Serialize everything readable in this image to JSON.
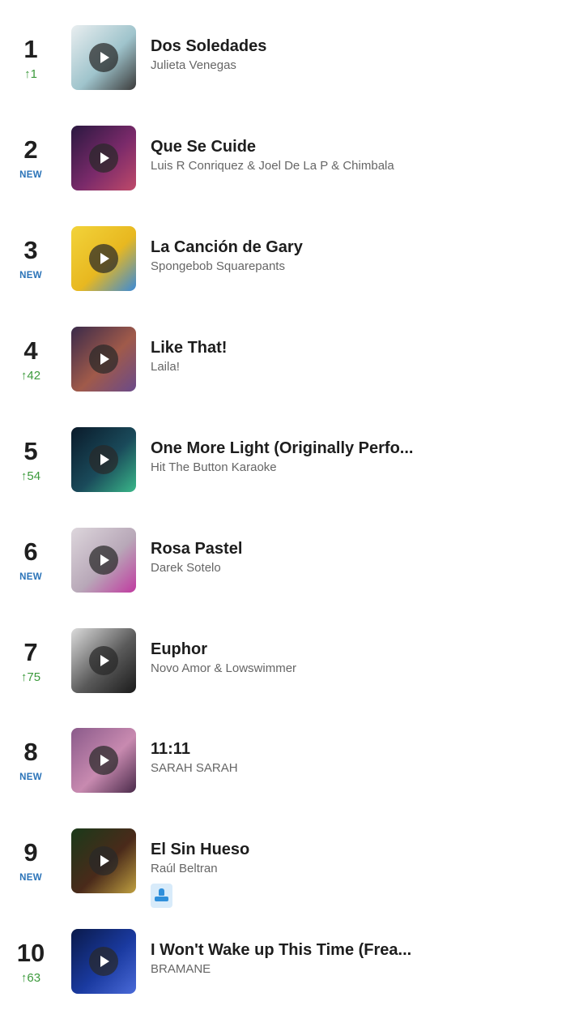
{
  "tracks": [
    {
      "rank": "1",
      "change": "1",
      "change_type": "up",
      "title": "Dos Soledades",
      "artist": "Julieta Venegas",
      "art_colors": [
        "#e9eef0",
        "#9fc4cc",
        "#3a3a3a"
      ]
    },
    {
      "rank": "2",
      "change": "NEW",
      "change_type": "new",
      "title": "Que Se Cuide",
      "artist": "Luis R Conriquez & Joel De La P & Chimbala",
      "art_colors": [
        "#2a1840",
        "#7a2a6a",
        "#c04a6a"
      ]
    },
    {
      "rank": "3",
      "change": "NEW",
      "change_type": "new",
      "title": "La Canción de Gary",
      "artist": "Spongebob Squarepants",
      "art_colors": [
        "#f2d33a",
        "#e8b820",
        "#3a8ad8"
      ]
    },
    {
      "rank": "4",
      "change": "42",
      "change_type": "up",
      "title": "Like That!",
      "artist": "Laila!",
      "art_colors": [
        "#3a2a4a",
        "#a05a4a",
        "#6a4a8a"
      ]
    },
    {
      "rank": "5",
      "change": "54",
      "change_type": "up",
      "title": "One More Light (Originally Perfo...",
      "artist": "Hit The Button Karaoke",
      "art_colors": [
        "#0a1a2a",
        "#1a4a5a",
        "#3ab88a"
      ]
    },
    {
      "rank": "6",
      "change": "NEW",
      "change_type": "new",
      "title": "Rosa Pastel",
      "artist": "Darek Sotelo",
      "art_colors": [
        "#ddd6dc",
        "#b8a8b8",
        "#c03aa0"
      ]
    },
    {
      "rank": "7",
      "change": "75",
      "change_type": "up",
      "title": "Euphor",
      "artist": "Novo Amor & Lowswimmer",
      "art_colors": [
        "#dcdcdc",
        "#5a5a5a",
        "#1a1a1a"
      ]
    },
    {
      "rank": "8",
      "change": "NEW",
      "change_type": "new",
      "title": "11:11",
      "artist": "SARAH SARAH",
      "art_colors": [
        "#8a5a8a",
        "#c88ab0",
        "#4a2a4a"
      ]
    },
    {
      "rank": "9",
      "change": "NEW",
      "change_type": "new",
      "title": "El Sin Hueso",
      "artist": "Raúl Beltran",
      "art_colors": [
        "#1a3a1a",
        "#4a2a1a",
        "#c0a040"
      ],
      "user_badge": "user-icon"
    },
    {
      "rank": "10",
      "change": "63",
      "change_type": "up",
      "title": "I Won't Wake up This Time (Frea...",
      "artist": "BRAMANE",
      "art_colors": [
        "#0a1a4a",
        "#1a3aa0",
        "#4a6ad8"
      ]
    }
  ],
  "colors": {
    "rank": "#1f1f1f",
    "up": "#3c9a3c",
    "new": "#2a73b8",
    "title": "#1d1d1d",
    "artist": "#666666"
  },
  "icons": {
    "up_arrow": "↑",
    "play": "play-icon"
  }
}
